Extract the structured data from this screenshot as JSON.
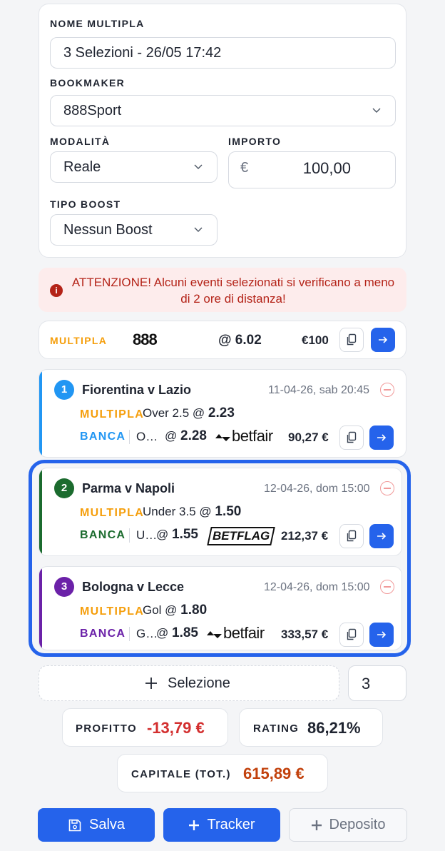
{
  "form": {
    "nome_label": "NOME MULTIPLA",
    "nome_value": "3 Selezioni - 26/05 17:42",
    "bookmaker_label": "BOOKMAKER",
    "bookmaker_value": "888Sport",
    "modalita_label": "MODALITÀ",
    "modalita_value": "Reale",
    "importo_label": "IMPORTO",
    "importo_currency": "€",
    "importo_value": "100,00",
    "boost_label": "TIPO BOOST",
    "boost_value": "Nessun Boost"
  },
  "alert": {
    "text": "ATTENZIONE! Alcuni eventi selezionati si verificano a meno di 2 ore di distanza!",
    "color": "#b42318"
  },
  "multipla": {
    "label": "MULTIPLA",
    "bookmaker_logo": "888",
    "odds": "@ 6.02",
    "stake": "€100"
  },
  "selections": [
    {
      "number": "1",
      "match": "Fiorentina v Lazio",
      "date": "11-04-26, sab 20:45",
      "color": "#2196f3",
      "mult_label": "MULTIPLA",
      "mult_market": "Over 2.5 @",
      "mult_odds": "2.23",
      "banca_label": "BANCA",
      "banca_market": "O…",
      "banca_at": "@",
      "banca_odds": "2.28",
      "exchange_logo": "betfair",
      "amount": "90,27 €"
    },
    {
      "number": "2",
      "match": "Parma v Napoli",
      "date": "12-04-26, dom 15:00",
      "color": "#1b6b2e",
      "mult_label": "MULTIPLA",
      "mult_market": "Under 3.5 @",
      "mult_odds": "1.50",
      "banca_label": "BANCA",
      "banca_market": "U…",
      "banca_at": "@",
      "banca_odds": "1.55",
      "exchange_logo": "BETFLAG",
      "amount": "212,37 €"
    },
    {
      "number": "3",
      "match": "Bologna v Lecce",
      "date": "12-04-26, dom 15:00",
      "color": "#6b21a8",
      "mult_label": "MULTIPLA",
      "mult_market": "Gol @",
      "mult_odds": "1.80",
      "banca_label": "BANCA",
      "banca_market": "G…",
      "banca_at": "@",
      "banca_odds": "1.85",
      "exchange_logo": "betfair",
      "amount": "333,57 €"
    }
  ],
  "add_selection_label": "Selezione",
  "selection_count": "3",
  "stats": {
    "profitto_label": "PROFITTO",
    "profitto_value": "-13,79 €",
    "rating_label": "RATING",
    "rating_value": "86,21%",
    "capitale_label": "CAPITALE (TOT.)",
    "capitale_value": "615,89 €"
  },
  "actions": {
    "salva": "Salva",
    "tracker": "Tracker",
    "deposito": "Deposito"
  },
  "colors": {
    "accent": "#2563eb",
    "multipla": "#f59e0b",
    "negative": "#d32f2f",
    "capitale": "#c2410c"
  }
}
